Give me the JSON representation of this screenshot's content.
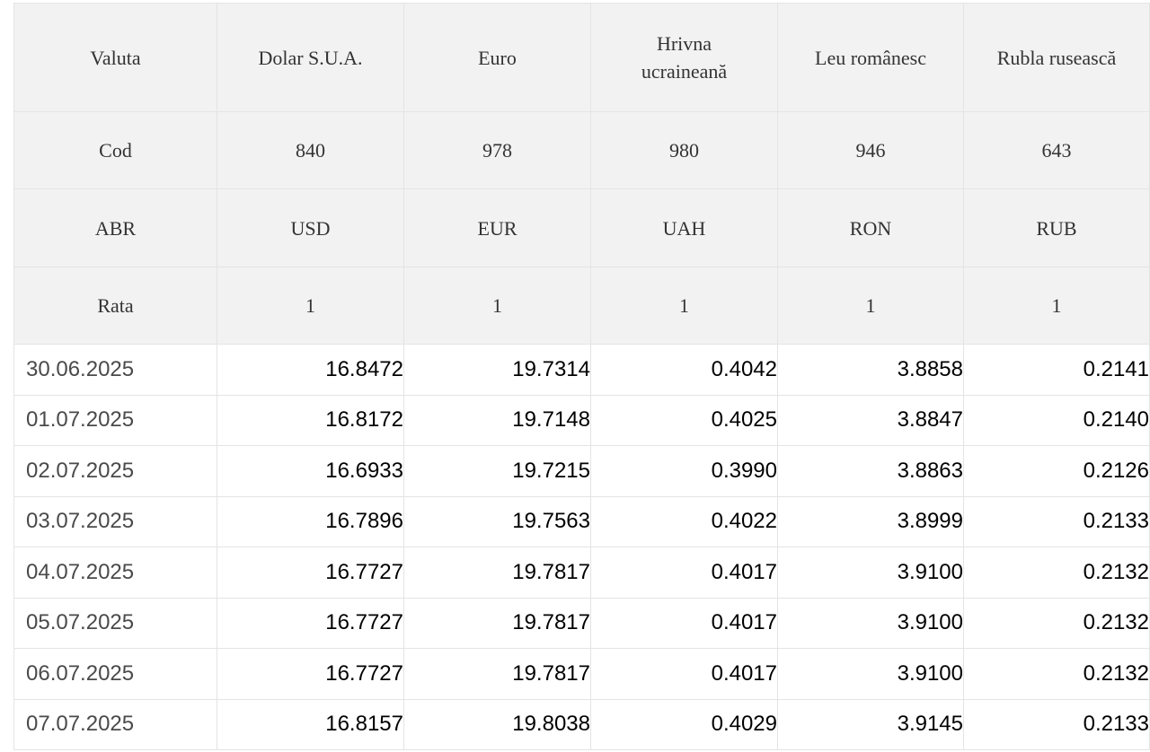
{
  "header": {
    "row_label_name": "Valuta",
    "row_label_code": "Cod",
    "row_label_abbr": "ABR",
    "row_label_rate": "Rata",
    "currencies": [
      {
        "name": "Dolar S.U.A.",
        "code": "840",
        "abbr": "USD",
        "rate": "1"
      },
      {
        "name": "Euro",
        "code": "978",
        "abbr": "EUR",
        "rate": "1"
      },
      {
        "name": "Hrivna ucraineană",
        "code": "980",
        "abbr": "UAH",
        "rate": "1"
      },
      {
        "name": "Leu românesc",
        "code": "946",
        "abbr": "RON",
        "rate": "1"
      },
      {
        "name": "Rubla rusească",
        "code": "643",
        "abbr": "RUB",
        "rate": "1"
      }
    ]
  },
  "rows": [
    {
      "date": "30.06.2025",
      "values": [
        "16.8472",
        "19.7314",
        "0.4042",
        "3.8858",
        "0.2141"
      ]
    },
    {
      "date": "01.07.2025",
      "values": [
        "16.8172",
        "19.7148",
        "0.4025",
        "3.8847",
        "0.2140"
      ]
    },
    {
      "date": "02.07.2025",
      "values": [
        "16.6933",
        "19.7215",
        "0.3990",
        "3.8863",
        "0.2126"
      ]
    },
    {
      "date": "03.07.2025",
      "values": [
        "16.7896",
        "19.7563",
        "0.4022",
        "3.8999",
        "0.2133"
      ]
    },
    {
      "date": "04.07.2025",
      "values": [
        "16.7727",
        "19.7817",
        "0.4017",
        "3.9100",
        "0.2132"
      ]
    },
    {
      "date": "05.07.2025",
      "values": [
        "16.7727",
        "19.7817",
        "0.4017",
        "3.9100",
        "0.2132"
      ]
    },
    {
      "date": "06.07.2025",
      "values": [
        "16.7727",
        "19.7817",
        "0.4017",
        "3.9100",
        "0.2132"
      ]
    },
    {
      "date": "07.07.2025",
      "values": [
        "16.8157",
        "19.8038",
        "0.4029",
        "3.9145",
        "0.2133"
      ]
    }
  ]
}
